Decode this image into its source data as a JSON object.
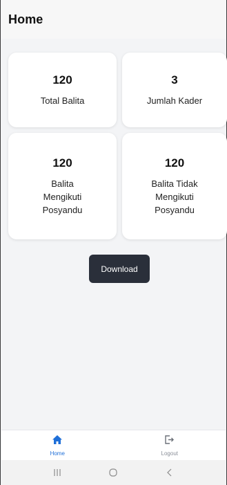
{
  "appbar": {
    "title": "Home"
  },
  "cards": [
    {
      "value": "120",
      "label": "Total Balita"
    },
    {
      "value": "3",
      "label": "Jumlah Kader"
    },
    {
      "value": "120",
      "label_lines": [
        "Balita",
        "Mengikuti",
        "Posyandu"
      ]
    },
    {
      "value": "120",
      "label_lines": [
        "Balita Tidak",
        "Mengikuti",
        "Posyandu"
      ]
    }
  ],
  "download_button": {
    "label": "Download"
  },
  "bottom_nav": {
    "items": [
      {
        "label": "Home",
        "icon": "home-icon",
        "active": true
      },
      {
        "label": "Logout",
        "icon": "logout-icon",
        "active": false
      }
    ]
  },
  "system_nav": {
    "icons": [
      "recents-icon",
      "home-circle-icon",
      "back-icon"
    ]
  },
  "colors": {
    "accent": "#1f6fd8",
    "button_bg": "#2a2f3a",
    "background": "#f3f4f6"
  }
}
